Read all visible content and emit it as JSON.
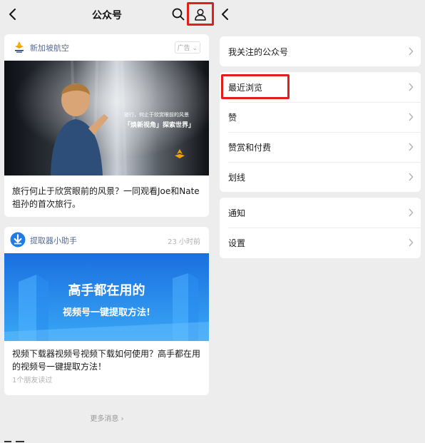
{
  "left": {
    "header_title": "公众号",
    "articles": [
      {
        "account": "新加坡航空",
        "tag": "广告",
        "banner_line1": "旅行，何止于欣赏眼前的风景",
        "banner_line2": "「焕新视角」探索世界」",
        "headline": "旅行何止于欣赏眼前的风景？一同观看Joe和Nate祖孙的首次旅行。"
      },
      {
        "account": "提取器小助手",
        "time": "23 小时前",
        "banner_line1": "高手都在用的",
        "banner_line2": "视频号一键提取方法!",
        "headline": "视频下载器视频号视频下载如何使用？高手都在用的视频号一键提取方法！",
        "friends": "1个朋友读过"
      }
    ],
    "more_label": "更多消息"
  },
  "right": {
    "menu_groups": [
      [
        {
          "label": "我关注的公众号"
        }
      ],
      [
        {
          "label": "最近浏览"
        },
        {
          "label": "赞"
        },
        {
          "label": "赞赏和付费"
        },
        {
          "label": "划线"
        }
      ],
      [
        {
          "label": "通知"
        },
        {
          "label": "设置"
        }
      ]
    ]
  },
  "colors": {
    "highlight": "#e0201c",
    "link_blue": "#576b95",
    "banner_blue": "#1e7be8"
  }
}
